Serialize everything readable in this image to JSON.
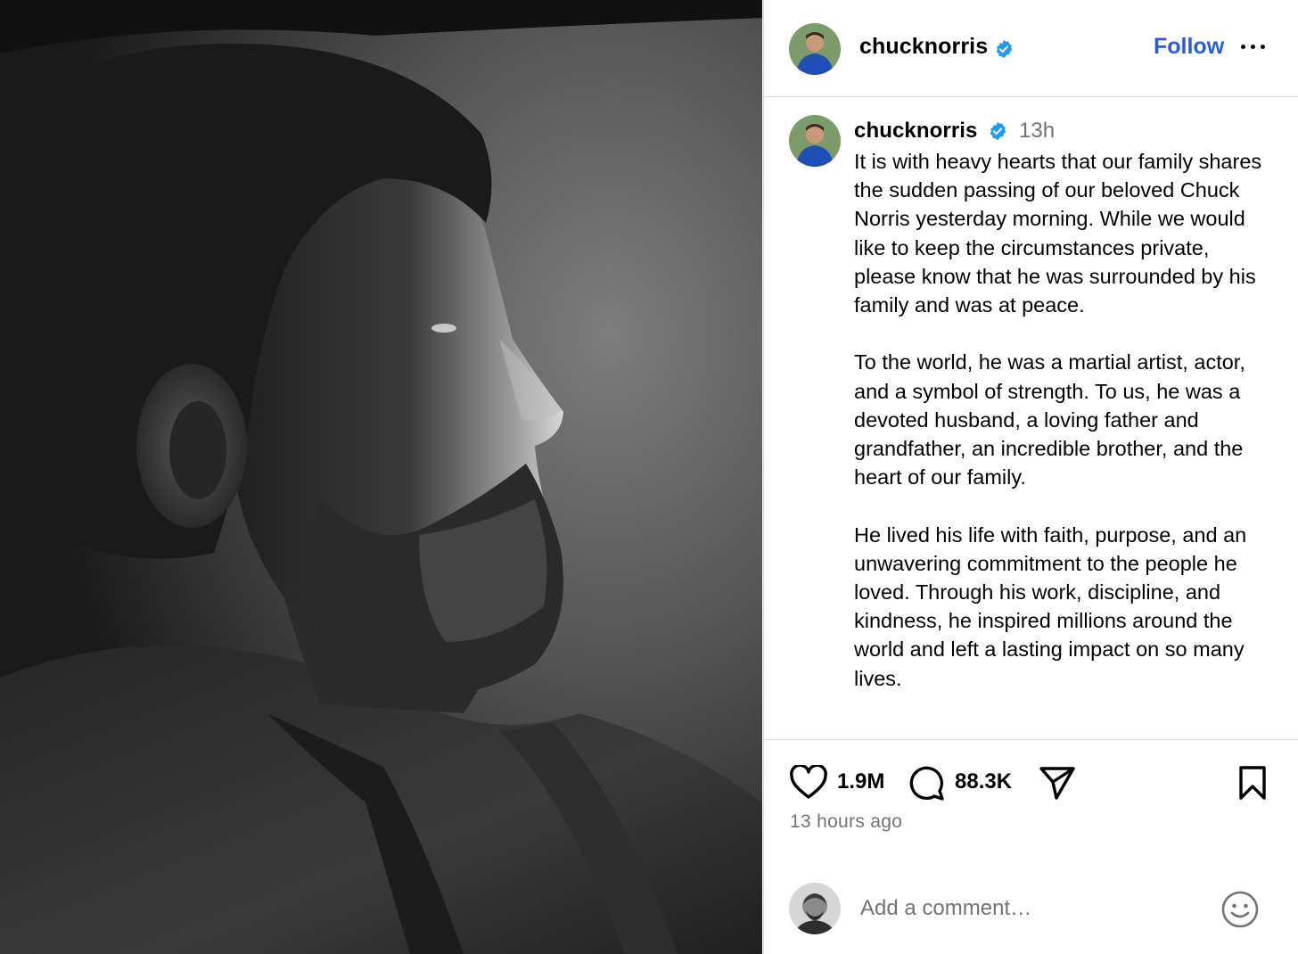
{
  "header": {
    "username": "chucknorris",
    "follow_label": "Follow"
  },
  "post": {
    "username": "chucknorris",
    "age": "13h",
    "caption": [
      "It is with heavy hearts that our family shares the sudden passing of our beloved Chuck Norris yesterday morning. While we would like to keep the circumstances private, please know that he was surrounded by his family and was at peace.",
      "To the world, he was a martial artist, actor, and a symbol of strength. To us, he was a devoted husband, a loving father and grandfather, an incredible brother, and the heart of our family.",
      "He lived his life with faith, purpose, and an unwavering commitment to the people he loved. Through his work, discipline, and kindness, he inspired millions around the world and left a lasting impact on so many lives."
    ]
  },
  "actions": {
    "likes": "1.9M",
    "comments": "88.3K",
    "posted_ago": "13 hours ago"
  },
  "comment_box": {
    "placeholder": "Add a comment…"
  },
  "icons": {
    "verified": "verified-badge-icon",
    "more": "more-options-icon",
    "like": "heart-icon",
    "comment": "comment-bubble-icon",
    "share": "share-paper-plane-icon",
    "save": "bookmark-icon",
    "emoji": "emoji-smiley-icon"
  },
  "colors": {
    "accent": "#2b5bd6",
    "verified": "#1d9bf0",
    "muted": "#737373",
    "divider": "#dbdbdb"
  }
}
